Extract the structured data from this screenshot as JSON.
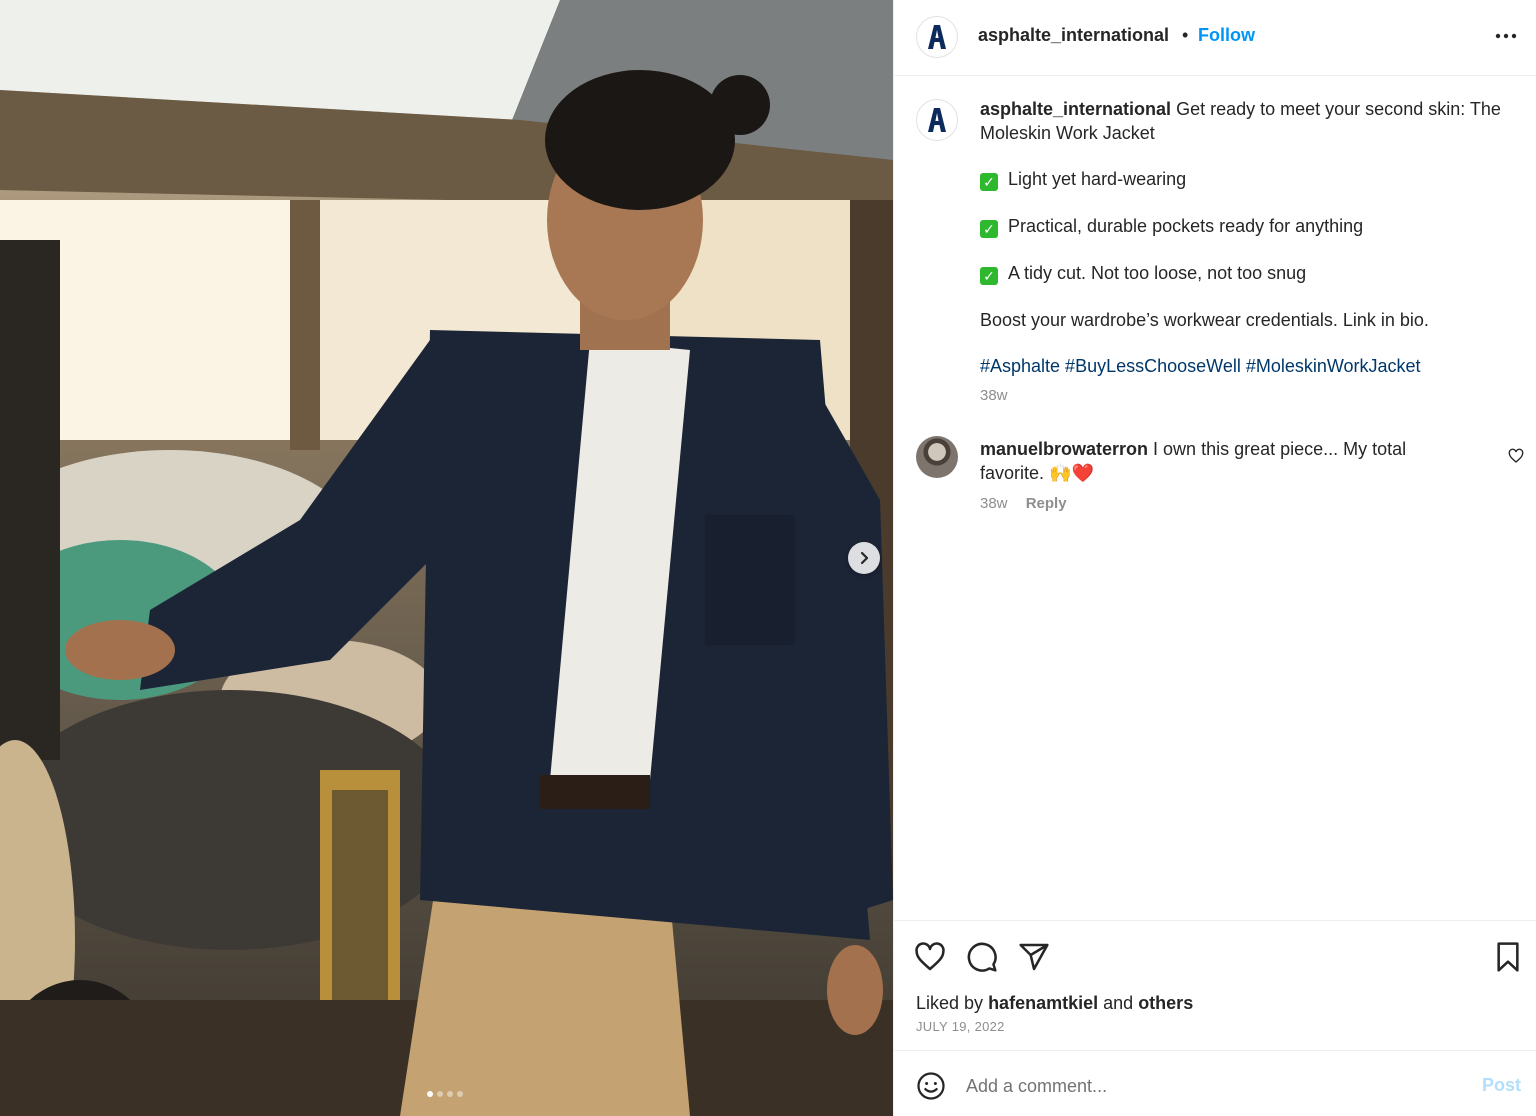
{
  "post": {
    "username": "asphalte_international",
    "follow_label": "Follow",
    "separator": "•",
    "avatar_letter": "A",
    "image_alt": "Man in navy moleskin work jacket standing in a garage",
    "carousel": {
      "slide_count": 4,
      "active_index": 0
    }
  },
  "caption": {
    "username": "asphalte_international",
    "intro": "Get ready to meet your second skin: The Moleskin Work Jacket",
    "bullets": [
      "Light yet hard-wearing",
      "Practical, durable pockets ready for anything",
      "A tidy cut. Not too loose, not too snug"
    ],
    "closing": "Boost your wardrobe’s workwear credentials. Link in bio.",
    "hashtags": "#Asphalte #BuyLessChooseWell #MoleskinWorkJacket",
    "time": "38w"
  },
  "comments": [
    {
      "username": "manuelbrowaterron",
      "text": "I own this great piece... My total favorite. 🙌❤️",
      "time": "38w",
      "reply_label": "Reply"
    }
  ],
  "footer": {
    "liked_by_prefix": "Liked by",
    "liked_by_user": "hafenamtkiel",
    "and_label": "and",
    "others_label": "others",
    "date": "JULY 19, 2022"
  },
  "add_comment": {
    "placeholder": "Add a comment...",
    "post_label": "Post"
  },
  "icons": {
    "more": "more-options-icon",
    "next": "chevron-right-icon",
    "like": "heart-icon",
    "comment": "comment-bubble-icon",
    "share": "paper-plane-icon",
    "save": "bookmark-icon",
    "emoji": "emoji-smile-icon"
  },
  "colors": {
    "follow": "#0095f6",
    "hashtag": "#00376b",
    "post_disabled": "#b2dffc",
    "muted": "#8e8e8e",
    "brand_navy": "#0d2a5c"
  }
}
